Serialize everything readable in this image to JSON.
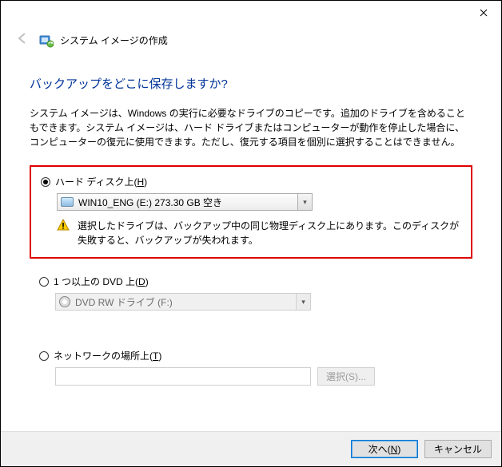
{
  "window": {
    "title": "システム イメージの作成"
  },
  "page": {
    "heading": "バックアップをどこに保存しますか?",
    "description": "システム イメージは、Windows の実行に必要なドライブのコピーです。追加のドライブを含めることもできます。システム イメージは、ハード ドライブまたはコンピューターが動作を停止した場合に、コンピューターの復元に使用できます。ただし、復元する項目を個別に選択することはできません。"
  },
  "options": {
    "hdd": {
      "label_pre": "ハード ディスク上(",
      "accel": "H",
      "label_post": ")",
      "selected": "WIN10_ENG (E:)  273.30 GB 空き",
      "warning": "選択したドライブは、バックアップ中の同じ物理ディスク上にあります。このディスクが失敗すると、バックアップが失われます。"
    },
    "dvd": {
      "label_pre": "1 つ以上の DVD 上(",
      "accel": "D",
      "label_post": ")",
      "selected": "DVD RW ドライブ (F:)"
    },
    "network": {
      "label_pre": "ネットワークの場所上(",
      "accel": "T",
      "label_post": ")",
      "value": "",
      "browse_pre": "選択(",
      "browse_accel": "S",
      "browse_post": ")..."
    }
  },
  "footer": {
    "next_pre": "次へ(",
    "next_accel": "N",
    "next_post": ")",
    "cancel": "キャンセル"
  }
}
